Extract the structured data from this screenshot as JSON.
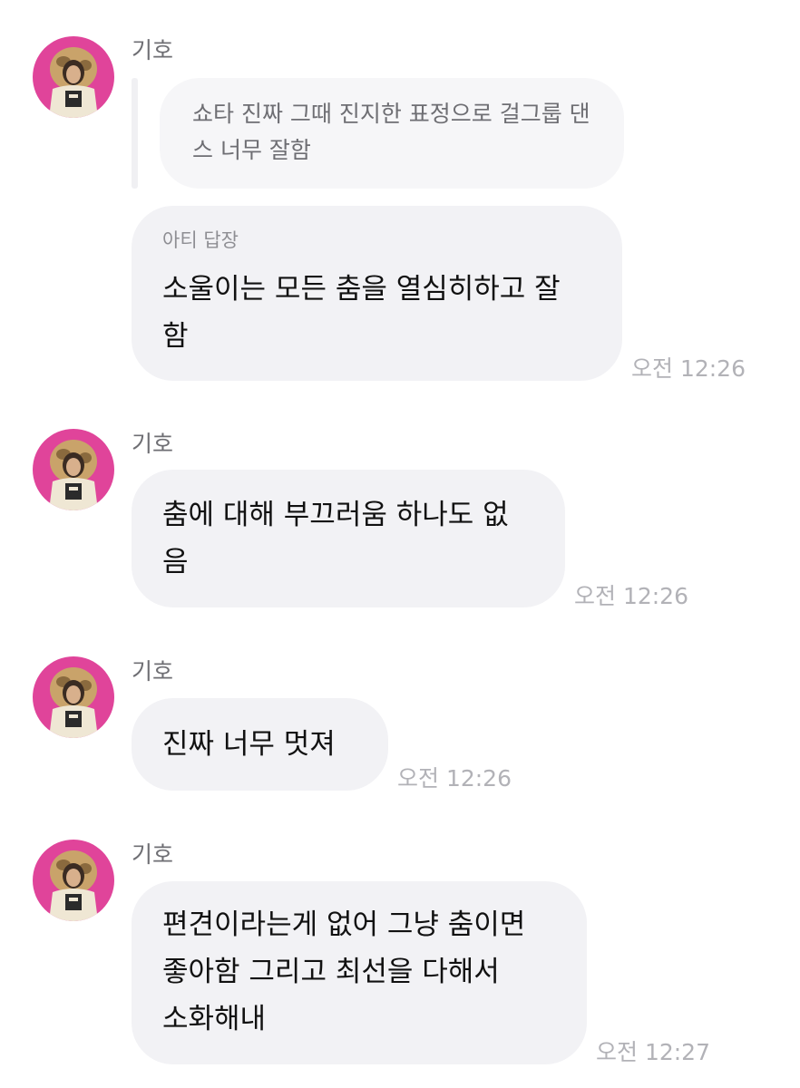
{
  "messages": [
    {
      "sender": "기호",
      "quoted": "쇼타 진짜 그때 진지한 표정으로 걸그룹 댄스 너무 잘함",
      "reply_label": "아티 답장",
      "text_lines": [
        "소울이는 모든 춤을 열심히하고 잘",
        "함"
      ],
      "time": "오전 12:26"
    },
    {
      "sender": "기호",
      "text_lines": [
        "춤에 대해 부끄러움 하나도 없",
        "음"
      ],
      "time": "오전 12:26"
    },
    {
      "sender": "기호",
      "text_lines": [
        "진짜 너무 멋져"
      ],
      "time": "오전 12:26"
    },
    {
      "sender": "기호",
      "text_lines": [
        "편견이라는게 없어 그냥 춤이면",
        "좋아함 그리고 최선을 다해서",
        "소화해내"
      ],
      "time": "오전 12:27"
    }
  ],
  "colors": {
    "bubble": "#f2f2f5",
    "quote_bubble": "#f6f6f8",
    "avatar_background": "#e0449a",
    "avatar_fur": "#c9a36a",
    "timestamp": "#b2b2b7"
  },
  "icons": {
    "avatar": "profile-photo-avatar"
  }
}
